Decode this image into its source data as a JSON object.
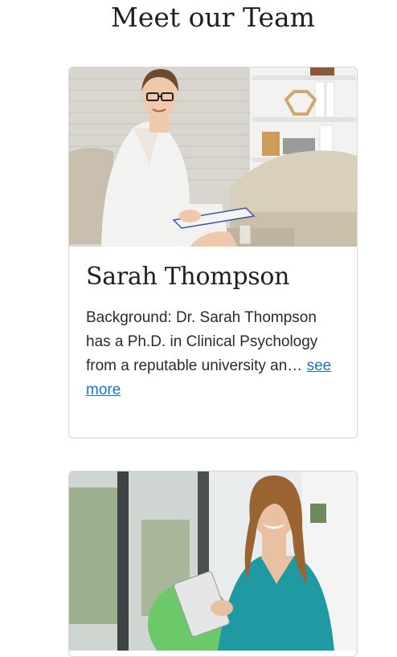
{
  "section": {
    "title": "Meet our Team"
  },
  "members": [
    {
      "name": "Sarah Thompson",
      "bio": "Background: Dr. Sarah Thompson has a Ph.D. in Clinical Psychology from a reputable university an…",
      "link_label": "see more"
    }
  ],
  "colors": {
    "link": "#1a6fd9",
    "border": "#d6d6d6"
  }
}
